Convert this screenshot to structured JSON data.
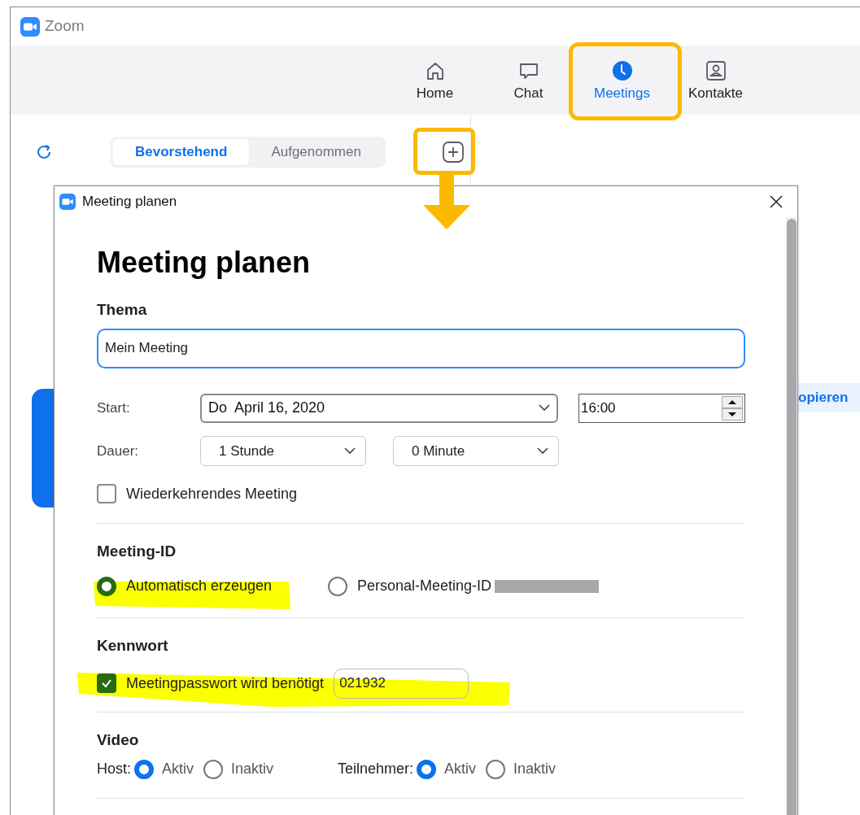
{
  "app": {
    "title": "Zoom"
  },
  "nav": [
    {
      "label": "Home",
      "kind": "home",
      "selected": false
    },
    {
      "label": "Chat",
      "kind": "chat",
      "selected": false
    },
    {
      "label": "Meetings",
      "kind": "clock",
      "selected": true
    },
    {
      "label": "Kontakte",
      "kind": "contact",
      "selected": false
    }
  ],
  "tabs": [
    {
      "label": "Bevorstehend",
      "selected": true
    },
    {
      "label": "Aufgenommen",
      "selected": false
    }
  ],
  "side_button": "opieren",
  "dialog": {
    "title": "Meeting planen",
    "heading": "Meeting planen",
    "topic": {
      "label": "Thema",
      "value": "Mein Meeting"
    },
    "start": {
      "label": "Start:",
      "date": "Do  April 16, 2020",
      "time": "16:00"
    },
    "duration": {
      "label": "Dauer:",
      "hours": "1 Stunde",
      "minutes": "0 Minute"
    },
    "recurring": {
      "label": "Wiederkehrendes Meeting",
      "checked": false
    },
    "meeting_id": {
      "heading": "Meeting-ID",
      "options": [
        {
          "label": "Automatisch erzeugen",
          "selected": true
        },
        {
          "label": "Personal-Meeting-ID",
          "selected": false
        }
      ]
    },
    "password": {
      "heading": "Kennwort",
      "label": "Meetingpasswort wird benötigt",
      "checked": true,
      "value": "021932"
    },
    "video": {
      "heading": "Video",
      "groups": [
        {
          "label": "Host:",
          "options": [
            {
              "label": "Aktiv",
              "selected": true
            },
            {
              "label": "Inaktiv",
              "selected": false
            }
          ]
        },
        {
          "label": "Teilnehmer:",
          "options": [
            {
              "label": "Aktiv",
              "selected": true
            },
            {
              "label": "Inaktiv",
              "selected": false
            }
          ]
        }
      ]
    }
  }
}
